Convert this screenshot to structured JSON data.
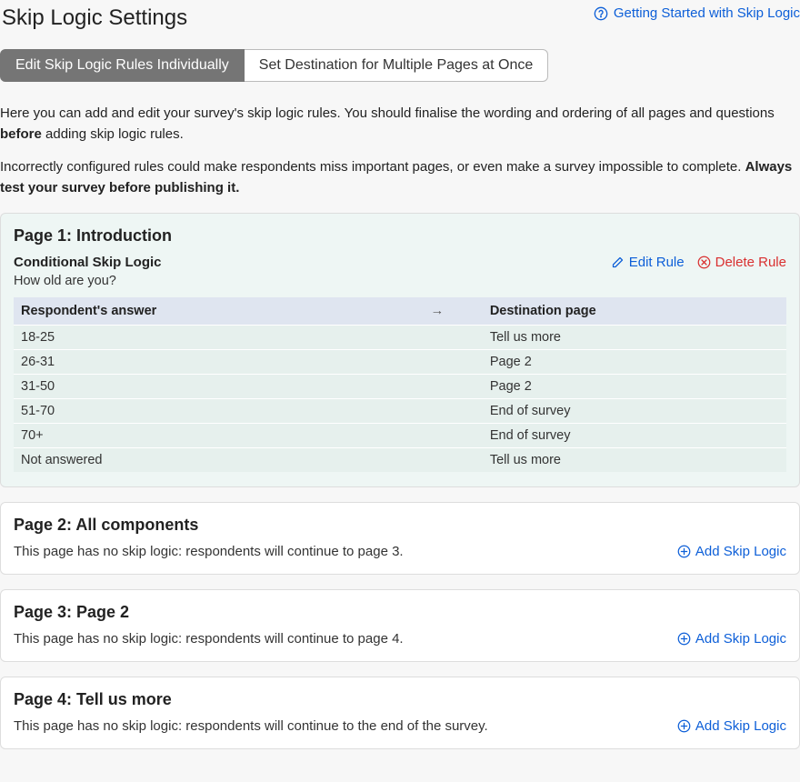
{
  "header": {
    "title": "Skip Logic Settings",
    "help_link": "Getting Started with Skip Logic"
  },
  "tabs": {
    "edit_individually": "Edit Skip Logic Rules Individually",
    "set_multiple": "Set Destination for Multiple Pages at Once"
  },
  "intro": {
    "p1_pre": "Here you can add and edit your survey's skip logic rules. You should finalise the wording and ordering of all pages and questions ",
    "p1_bold": "before",
    "p1_post": " adding skip logic rules.",
    "p2_pre": "Incorrectly configured rules could make respondents miss important pages, or even make a survey impossible to complete. ",
    "p2_bold": "Always test your survey before publishing it."
  },
  "actions": {
    "edit_rule": "Edit Rule",
    "delete_rule": "Delete Rule",
    "add_skip_logic": "Add Skip Logic"
  },
  "table_headers": {
    "answer": "Respondent's answer",
    "arrow": "→",
    "destination": "Destination page"
  },
  "pages": [
    {
      "title": "Page 1: Introduction",
      "rule_type": "Conditional Skip Logic",
      "question": "How old are you?",
      "rows": [
        {
          "answer": "18-25",
          "destination": "Tell us more"
        },
        {
          "answer": "26-31",
          "destination": "Page 2"
        },
        {
          "answer": "31-50",
          "destination": "Page 2"
        },
        {
          "answer": "51-70",
          "destination": "End of survey"
        },
        {
          "answer": "70+",
          "destination": "End of survey"
        },
        {
          "answer": "Not answered",
          "destination": "Tell us more"
        }
      ]
    },
    {
      "title": "Page 2: All components",
      "no_logic_text": "This page has no skip logic: respondents will continue to page 3."
    },
    {
      "title": "Page 3: Page 2",
      "no_logic_text": "This page has no skip logic: respondents will continue to page 4."
    },
    {
      "title": "Page 4: Tell us more",
      "no_logic_text": "This page has no skip logic: respondents will continue to the end of the survey."
    }
  ]
}
